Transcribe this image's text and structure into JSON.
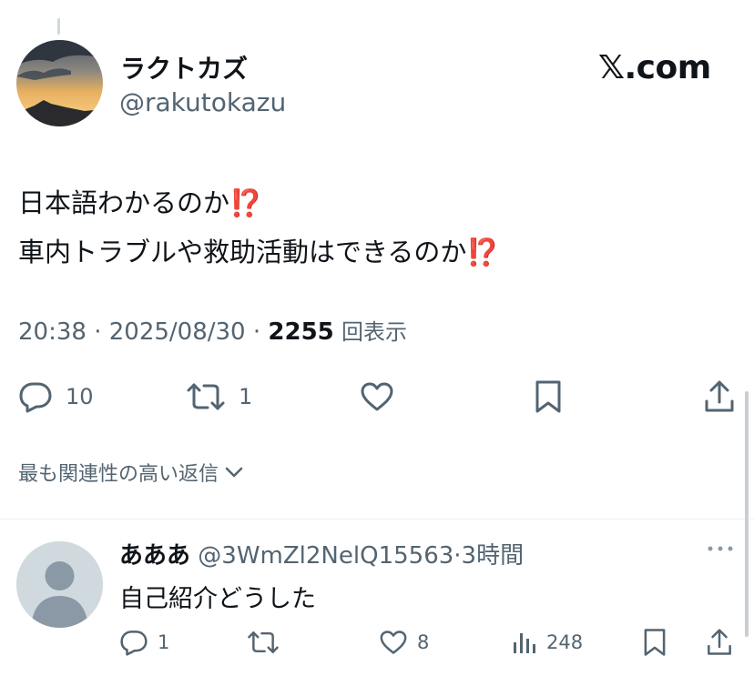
{
  "author": {
    "display_name": "ラクトカズ",
    "handle": "@rakutokazu"
  },
  "brand": "𝕏.com",
  "tweet": {
    "lines": [
      "日本語わかるのか⁉️",
      "車内トラブルや救助活動はできるのか⁉️"
    ],
    "time": "20:38",
    "separator": "·",
    "date": "2025/08/30",
    "views_count": "2255",
    "views_label": "回表示",
    "actions": {
      "reply_count": "10",
      "retweet_count": "1"
    }
  },
  "replies_sort": {
    "label": "最も関連性の高い返信"
  },
  "reply": {
    "name": "あああ",
    "handle": "@3WmZl2NelQ15563",
    "separator": "·",
    "time_ago": "3時間",
    "text": "自己紹介どうした",
    "actions": {
      "reply_count": "1",
      "like_count": "8",
      "views_count": "248"
    }
  },
  "colors": {
    "text": "#0f1419",
    "muted": "#536471",
    "divider": "#eff3f4"
  },
  "icons": [
    "reply-icon",
    "retweet-icon",
    "like-icon",
    "bookmark-icon",
    "share-icon",
    "views-icon",
    "more-icon",
    "chevron-down-icon"
  ]
}
